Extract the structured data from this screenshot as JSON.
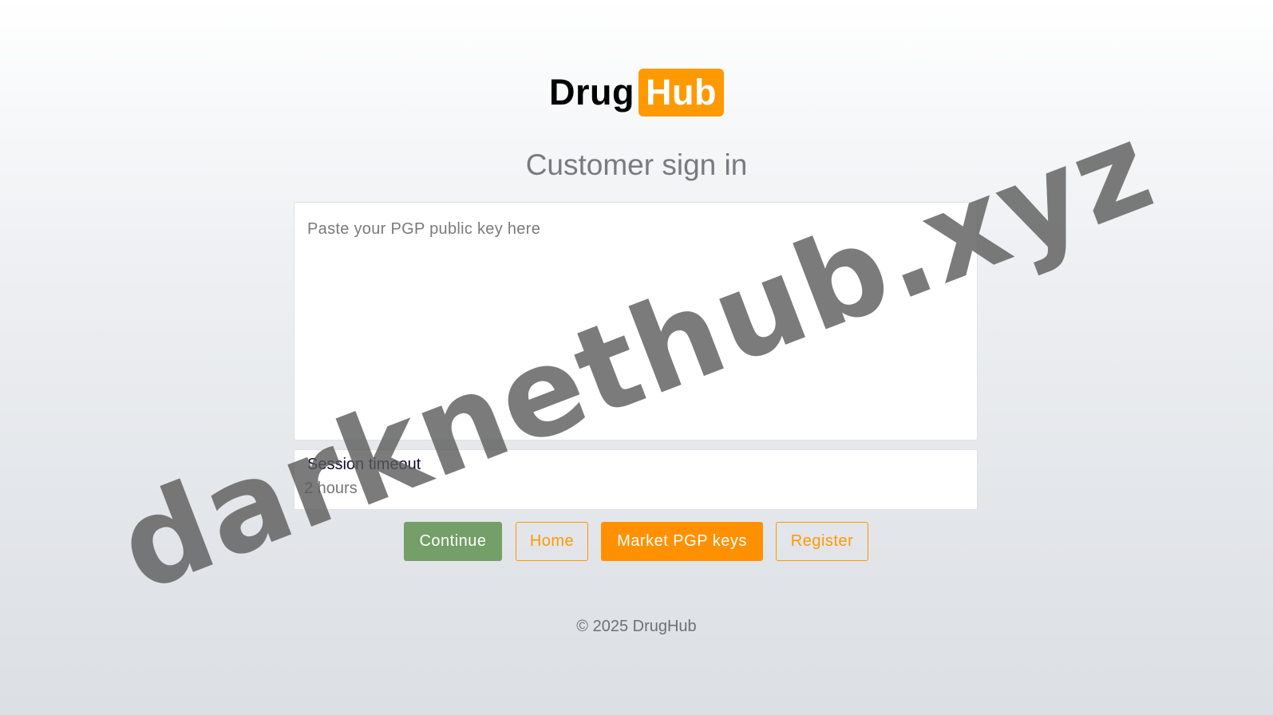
{
  "logo": {
    "part1": "Drug",
    "part2": "Hub"
  },
  "page_title": "Customer sign in",
  "pgp_input": {
    "placeholder": "Paste your PGP public key here",
    "value": ""
  },
  "session": {
    "label": "Session timeout",
    "value": "2 hours"
  },
  "buttons": {
    "continue": "Continue",
    "home": "Home",
    "market_pgp": "Market PGP keys",
    "register": "Register"
  },
  "footer": "© 2025 DrugHub",
  "watermark": "darknethub.xyz",
  "colors": {
    "brand_orange": "#ff9900",
    "continue_green": "#749f68"
  }
}
